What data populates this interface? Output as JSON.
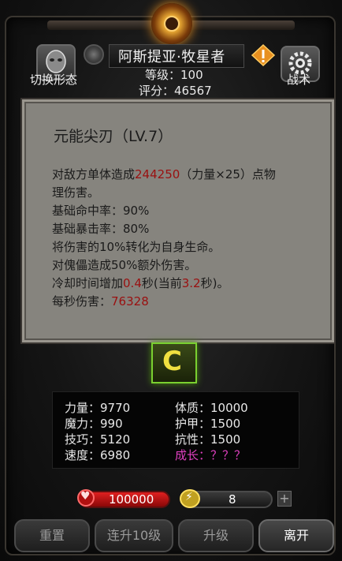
{
  "header": {
    "hero_name": "阿斯提亚·牧星者",
    "level": "等级：100",
    "score": "评分：46567",
    "switch_form_label": "切换形态",
    "tactics_label": "战术"
  },
  "tooltip": {
    "title": "元能尖刃（LV.7）",
    "line1_pre": "对敌方单体造成",
    "line1_damage": "244250",
    "line1_post": "（力量×25）点物",
    "line2": "理伤害。",
    "line3": "基础命中率：90%",
    "line4": "基础暴击率：80%",
    "line5": "将伤害的10%转化为自身生命。",
    "line6": "对傀儡造成50%额外伤害。",
    "line7_pre": "冷却时间增加",
    "line7_val": "0.4",
    "line7_mid": "秒(当前",
    "line7_cur": "3.2",
    "line7_post": "秒)。",
    "line8_pre": "每秒伤害：",
    "line8_val": "76328"
  },
  "skill": {
    "icon_glyph": "C"
  },
  "stats": {
    "strength": "力量：9770",
    "magic": "魔力：990",
    "skill": "技巧：5120",
    "speed": "速度：6980",
    "constitution": "体质：10000",
    "armor": "护甲：1500",
    "resistance": "抗性：1500",
    "growth": "成长：？？？"
  },
  "resources": {
    "hp": "100000",
    "energy": "8",
    "plus": "+"
  },
  "buttons": {
    "reset": "重置",
    "multi_upgrade": "连升10级",
    "upgrade": "升级",
    "leave": "离开"
  },
  "colors": {
    "highlight_red": "#9a1010",
    "growth_pink": "#e040c0",
    "skill_border_green": "#7ad030"
  }
}
